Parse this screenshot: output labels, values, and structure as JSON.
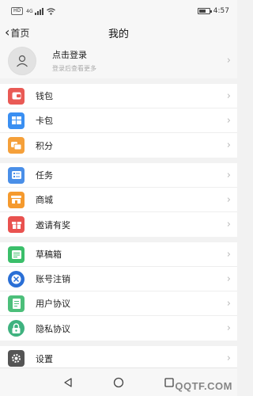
{
  "status_bar": {
    "sim_label": "HD",
    "network": "4G",
    "time": "4:57",
    "battery_level": 0.7
  },
  "nav": {
    "back_label": "首页",
    "title": "我的"
  },
  "profile": {
    "login_title": "点击登录",
    "login_subtitle": "登录后查看更多"
  },
  "menu_groups": [
    [
      {
        "label": "钱包",
        "icon": "wallet-icon",
        "color": "#e95a55"
      },
      {
        "label": "卡包",
        "icon": "card-icon",
        "color": "#3a8ff2"
      },
      {
        "label": "积分",
        "icon": "points-icon",
        "color": "#f5a03a"
      }
    ],
    [
      {
        "label": "任务",
        "icon": "task-icon",
        "color": "#4a8fe8"
      },
      {
        "label": "商城",
        "icon": "store-icon",
        "color": "#f59a2e"
      },
      {
        "label": "邀请有奖",
        "icon": "gift-icon",
        "color": "#e9524f"
      }
    ],
    [
      {
        "label": "草稿箱",
        "icon": "draft-icon",
        "color": "#3bbf6a"
      },
      {
        "label": "账号注销",
        "icon": "cancel-account-icon",
        "color": "#2a6fd6"
      },
      {
        "label": "用户协议",
        "icon": "agreement-icon",
        "color": "#4cbf7a"
      },
      {
        "label": "隐私协议",
        "icon": "privacy-lock-icon",
        "color": "#3fb27f"
      }
    ],
    [
      {
        "label": "设置",
        "icon": "settings-icon",
        "color": "#555555"
      }
    ]
  ],
  "arrow_glyph": "›",
  "watermark": "QQTF.COM"
}
